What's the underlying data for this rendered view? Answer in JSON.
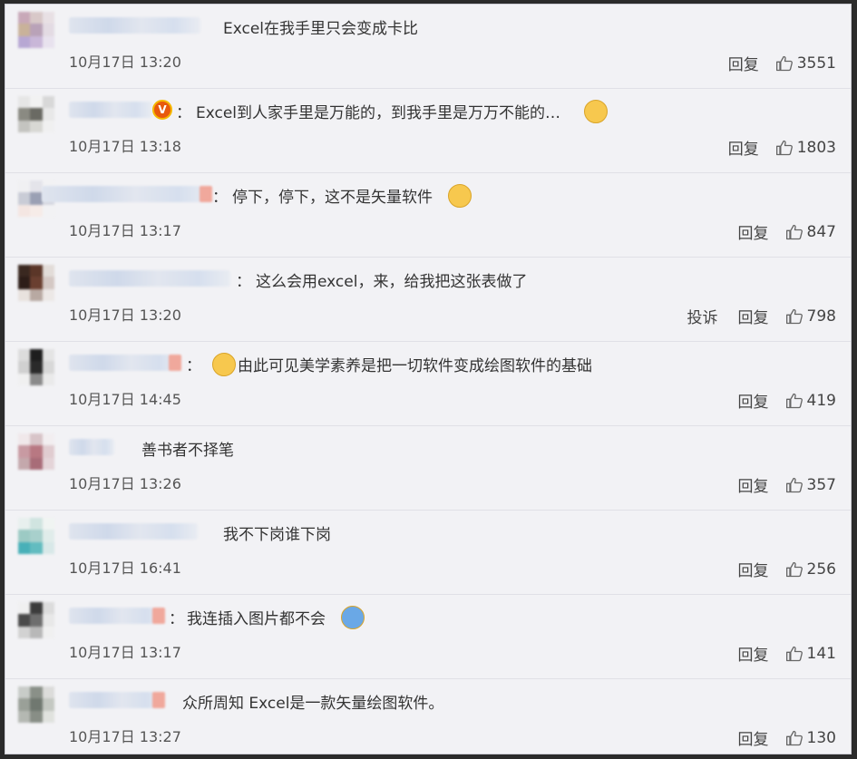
{
  "comments": [
    {
      "text": "Excel在我手里只会变成卡比",
      "time": "10月17日 13:20",
      "reply": "回复",
      "likes": "3551",
      "colors": [
        "#c8a8b8",
        "#d8c8c8",
        "#e8e0e4",
        "#c9b29a",
        "#b9a2b8",
        "#e3dbe3",
        "#b7a7d3",
        "#c9b7d8",
        "#e8e2ee"
      ]
    },
    {
      "text": "Excel到人家手里是万能的，到我手里是万万不能的…",
      "time": "10月17日 13:18",
      "reply": "回复",
      "likes": "1803",
      "badge": "V",
      "colors": [
        "#e6e6e6",
        "#f2f2f2",
        "#d8d8d8",
        "#8a8a82",
        "#6a6a63",
        "#e8e8e8",
        "#c4c4c0",
        "#d8d8d4",
        "#f0f0f0"
      ]
    },
    {
      "text": "停下，停下，这不是矢量软件",
      "time": "10月17日 13:17",
      "reply": "回复",
      "likes": "847",
      "colors": [
        "#f0f0f2",
        "#e4e4ea",
        "#f2f2f4",
        "#c9ccd6",
        "#9aa0b4",
        "#d6d8e0",
        "#f4e6e2",
        "#f6ece8",
        "#f2f2f4"
      ]
    },
    {
      "text": "这么会用excel，来，给我把这张表做了",
      "time": "10月17日 13:20",
      "report": "投诉",
      "reply": "回复",
      "likes": "798",
      "colors": [
        "#3a2820",
        "#5b3628",
        "#e2dcd8",
        "#2d1d18",
        "#6a3f30",
        "#d4c8c4",
        "#e8e2de",
        "#b8a9a2",
        "#ece8e6"
      ]
    },
    {
      "text": "由此可见美学素养是把一切软件变成绘图软件的基础",
      "time": "10月17日 14:45",
      "reply": "回复",
      "likes": "419",
      "colors": [
        "#dcdcdc",
        "#1e1e1e",
        "#e4e4e4",
        "#d0d0d0",
        "#2a2a2a",
        "#d8d8d8",
        "#f0f0f0",
        "#8a8a8a",
        "#eaeaea"
      ]
    },
    {
      "text": "善书者不择笔",
      "time": "10月17日 13:26",
      "reply": "回复",
      "likes": "357",
      "colors": [
        "#f0e8ea",
        "#d8c4c8",
        "#f2eef0",
        "#c89aa2",
        "#b87882",
        "#e0ccd0",
        "#c4a8ac",
        "#a86c78",
        "#e4d4d8"
      ]
    },
    {
      "text": "我不下岗谁下岗",
      "time": "10月17日 16:41",
      "reply": "回复",
      "likes": "256",
      "colors": [
        "#e8f0ee",
        "#d0e4e0",
        "#f0f4f2",
        "#9ccac4",
        "#a8d0cc",
        "#e0ecea",
        "#48b0b8",
        "#62bcc0",
        "#d8e8e8"
      ]
    },
    {
      "text": "我连插入图片都不会",
      "time": "10月17日 13:17",
      "reply": "回复",
      "likes": "141",
      "colors": [
        "#f0f0f0",
        "#3c3c3c",
        "#dcdcdc",
        "#4a4a4a",
        "#6e6e6e",
        "#e8e8e8",
        "#d2d2d2",
        "#b8b8b8",
        "#f0f0f0"
      ]
    },
    {
      "text": "众所周知 Excel是一款矢量绘图软件。",
      "time": "10月17日 13:27",
      "reply": "回复",
      "likes": "130",
      "colors": [
        "#c8ccc8",
        "#8a9088",
        "#dcdcda",
        "#9aa098",
        "#707870",
        "#c4c8c2",
        "#b4b8b2",
        "#888e86",
        "#e0e2de"
      ]
    }
  ]
}
